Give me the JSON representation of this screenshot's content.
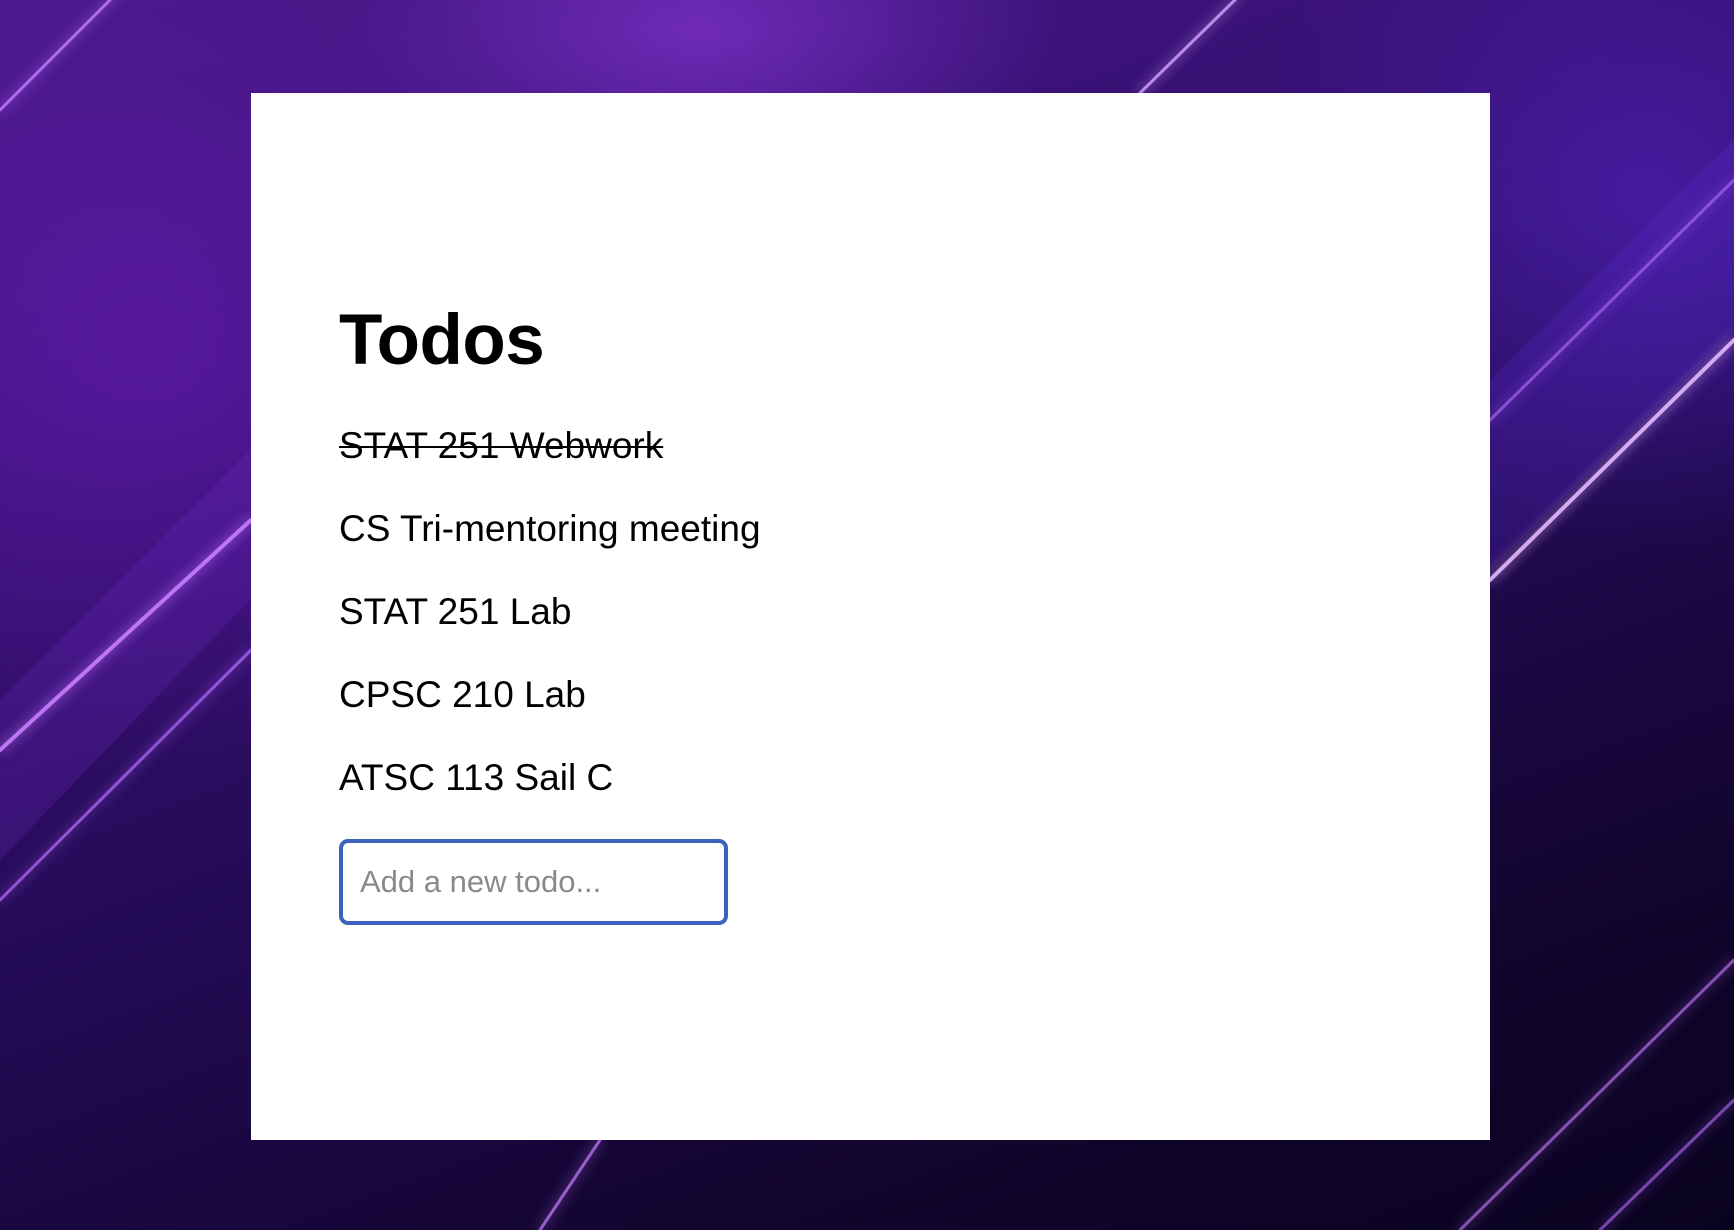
{
  "app": {
    "title": "Todos"
  },
  "todos": [
    {
      "label": "STAT 251 Webwork",
      "done": true
    },
    {
      "label": "CS Tri-mentoring meeting",
      "done": false
    },
    {
      "label": "STAT 251 Lab",
      "done": false
    },
    {
      "label": "CPSC 210 Lab",
      "done": false
    },
    {
      "label": "ATSC 113 Sail C",
      "done": false
    }
  ],
  "new_todo": {
    "value": "",
    "placeholder": "Add a new todo...",
    "focused": true
  },
  "colors": {
    "card_background": "#ffffff",
    "input_border_focus": "#3b63bd",
    "background_purple": "#3a1278",
    "streak_glow": "#c77dff"
  }
}
